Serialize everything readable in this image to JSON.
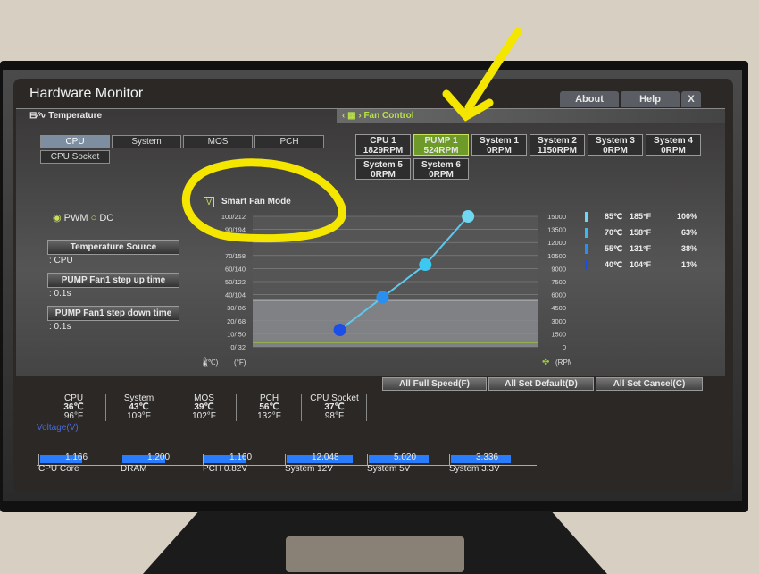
{
  "window": {
    "title": "Hardware Monitor",
    "about": "About",
    "help": "Help",
    "close": "X"
  },
  "temperature": {
    "heading": "Temperature",
    "sources": [
      "CPU",
      "System",
      "MOS",
      "PCH",
      "CPU Socket"
    ],
    "selected": "CPU"
  },
  "fan_control": {
    "heading": "Fan Control",
    "fans": [
      {
        "name": "CPU 1",
        "rpm": "1829RPM"
      },
      {
        "name": "PUMP 1",
        "rpm": "524RPM",
        "selected": true
      },
      {
        "name": "System 1",
        "rpm": "0RPM"
      },
      {
        "name": "System 2",
        "rpm": "1150RPM"
      },
      {
        "name": "System 3",
        "rpm": "0RPM"
      },
      {
        "name": "System 4",
        "rpm": "0RPM"
      },
      {
        "name": "System 5",
        "rpm": "0RPM"
      },
      {
        "name": "System 6",
        "rpm": "0RPM"
      }
    ]
  },
  "mode": {
    "pwm": "PWM",
    "dc": "DC",
    "selected": "PWM"
  },
  "settings": [
    {
      "label": "Temperature Source",
      "value": ": CPU"
    },
    {
      "label": "PUMP Fan1 step up time",
      "value": ": 0.1s"
    },
    {
      "label": "PUMP Fan1 step down time",
      "value": ": 0.1s"
    }
  ],
  "smart_fan": {
    "label": "Smart Fan Mode",
    "checked": true,
    "check": "V"
  },
  "chart_data": {
    "type": "line",
    "left_ticks": [
      "100/212",
      "90/194",
      "",
      "70/158",
      "60/140",
      "50/122",
      "40/104",
      "30/ 86",
      "20/ 68",
      "10/ 50",
      "0/ 32"
    ],
    "right_ticks": [
      "15000",
      "13500",
      "12000",
      "10500",
      "9000",
      "7500",
      "6000",
      "4500",
      "3000",
      "1500",
      "0"
    ],
    "left_unit_c": "(℃)",
    "left_unit_f": "(°F)",
    "right_unit": "(RPM)",
    "curve_points": [
      {
        "temp_c": 40,
        "percent": 13
      },
      {
        "temp_c": 55,
        "percent": 38
      },
      {
        "temp_c": 70,
        "percent": 63
      },
      {
        "temp_c": 85,
        "percent": 100
      }
    ],
    "current_temp_c": 36,
    "current_rpm": 524,
    "rpm_max": 15000,
    "colors": {
      "curve": "#5ec8f0",
      "temp_line": "#ffffff",
      "rpm_line": "#9acd32"
    }
  },
  "curve_legend": [
    {
      "c": "85℃",
      "f": "185°F",
      "p": "100%"
    },
    {
      "c": "70℃",
      "f": "158°F",
      "p": "63%"
    },
    {
      "c": "55℃",
      "f": "131°F",
      "p": "38%"
    },
    {
      "c": "40℃",
      "f": "104°F",
      "p": "13%"
    }
  ],
  "actions": {
    "full": "All Full Speed(F)",
    "default": "All Set Default(D)",
    "cancel": "All Set Cancel(C)"
  },
  "readings": [
    {
      "name": "CPU",
      "c": "36℃",
      "f": "96°F"
    },
    {
      "name": "System",
      "c": "43℃",
      "f": "109°F"
    },
    {
      "name": "MOS",
      "c": "39℃",
      "f": "102°F"
    },
    {
      "name": "PCH",
      "c": "56℃",
      "f": "132°F"
    },
    {
      "name": "CPU Socket",
      "c": "37℃",
      "f": "98°F"
    }
  ],
  "voltage": {
    "heading": "Voltage(V)",
    "items": [
      {
        "name": "CPU Core",
        "value": "1.166",
        "v": 1.166
      },
      {
        "name": "DRAM",
        "value": "1.200",
        "v": 1.2
      },
      {
        "name": "PCH 0.82V",
        "value": "1.160",
        "v": 1.16
      },
      {
        "name": "System 12V",
        "value": "12.048",
        "v": 12.048
      },
      {
        "name": "System 5V",
        "value": "5.020",
        "v": 5.02
      },
      {
        "name": "System 3.3V",
        "value": "3.336",
        "v": 3.336
      }
    ]
  },
  "annotation_color": "#f5e600"
}
